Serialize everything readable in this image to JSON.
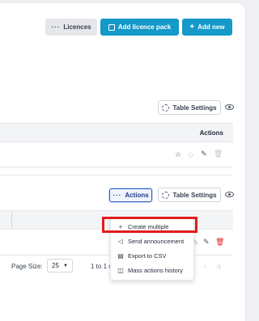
{
  "header": {
    "licences_label": "Licences",
    "add_licence_pack_label": "Add licence pack",
    "add_new_label": "Add new"
  },
  "table1": {
    "settings_label": "Table Settings",
    "actions_header": "Actions"
  },
  "table2": {
    "actions_button_label": "Actions",
    "settings_label": "Table Settings",
    "page_size_label": "Page Size:",
    "page_size_value": "25",
    "range_text": "1 to 1 o"
  },
  "dropdown": {
    "items": [
      {
        "label": "Create multiple",
        "icon": "plus-icon"
      },
      {
        "label": "Send announcement",
        "icon": "megaphone-icon"
      },
      {
        "label": "Export to CSV",
        "icon": "export-icon"
      },
      {
        "label": "Mass actions history",
        "icon": "history-icon"
      }
    ]
  },
  "colors": {
    "primary_blue": "#1499c8",
    "highlight_red": "#e11d1d",
    "delete_red": "#dc2626"
  }
}
